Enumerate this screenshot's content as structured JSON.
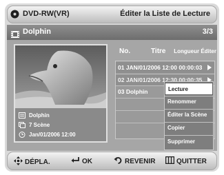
{
  "header": {
    "disc_label": "DVD-RW(VR)",
    "title": "Éditer la Liste de Lecture"
  },
  "subheader": {
    "playlist_name": "Dolphin",
    "page": "3/3"
  },
  "info": {
    "title": "Dolphin",
    "scenes": "7 Scène",
    "date": "Jan/01/2006 12:00"
  },
  "list": {
    "headers": {
      "no": "No.",
      "title": "Titre",
      "length": "Longueur Éditer"
    },
    "rows": [
      {
        "text": "01 JAN/01/2006 12:00 00:00:03"
      },
      {
        "text": "02 JAN/01/2006 12:30 00:00:35"
      },
      {
        "text": "03 Dolphin"
      }
    ]
  },
  "menu": {
    "items": [
      "Lecture",
      "Renommer",
      "Éditer la Scène",
      "Copier",
      "Supprimer"
    ],
    "selected_index": 0
  },
  "footer": {
    "move": "DÉPLA.",
    "ok": "OK",
    "back": "REVENIR",
    "quit": "QUITTER"
  }
}
